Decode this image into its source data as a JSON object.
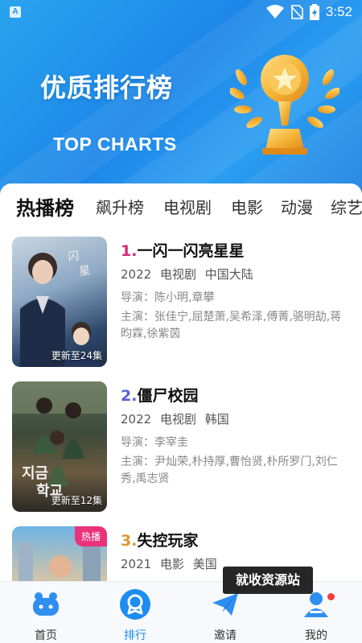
{
  "status_bar": {
    "app_icon_letter": "A",
    "time": "3:52"
  },
  "hero": {
    "title": "优质排行榜",
    "subtitle": "TOP CHARTS"
  },
  "tabs": [
    {
      "label": "热播榜",
      "active": true
    },
    {
      "label": "飙升榜",
      "active": false
    },
    {
      "label": "电视剧",
      "active": false
    },
    {
      "label": "电影",
      "active": false
    },
    {
      "label": "动漫",
      "active": false
    },
    {
      "label": "综艺",
      "active": false
    }
  ],
  "items": [
    {
      "rank": "1.",
      "rank_color": "#d8287a",
      "title": "一闪一闪亮星星",
      "year": "2022",
      "type": "电视剧",
      "region": "中国大陆",
      "director": "导演：陈小明,章攀",
      "cast": "主演：张佳宁,屈楚萧,吴希泽,傅菁,骆明劼,蒋昀霖,徐紫茵",
      "poster_text": "更新至24集"
    },
    {
      "rank": "2.",
      "rank_color": "#5a5fd8",
      "title": "僵尸校园",
      "year": "2022",
      "type": "电视剧",
      "region": "韩国",
      "director": "导演：李宰圭",
      "cast": "主演：尹灿荣,朴持厚,曹怡贤,朴所罗门,刘仁秀,禹志贤",
      "poster_text": "更新至12集"
    },
    {
      "rank": "3.",
      "rank_color": "#d89a2a",
      "title": "失控玩家",
      "year": "2021",
      "type": "电影",
      "region": "美国",
      "badge": "热播"
    }
  ],
  "bottom_nav": [
    {
      "label": "首页",
      "icon": "home-icon"
    },
    {
      "label": "排行",
      "icon": "ranking-icon",
      "active": true
    },
    {
      "label": "邀请",
      "icon": "invite-icon"
    },
    {
      "label": "我的",
      "icon": "profile-icon"
    }
  ],
  "toast": "就收资源站",
  "colors": {
    "accent": "#1c8cf0",
    "hero": "#2196f3",
    "badge": "#e8337a"
  }
}
